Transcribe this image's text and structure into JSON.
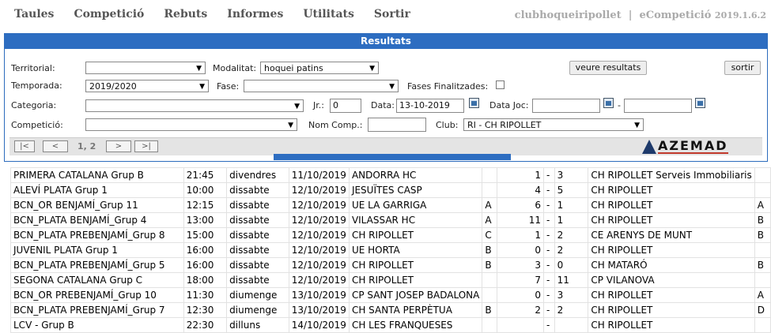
{
  "menu": [
    "Taules",
    "Competició",
    "Rebuts",
    "Informes",
    "Utilitats",
    "Sortir"
  ],
  "brand": {
    "club": "clubhoqueiripollet",
    "separator": "|",
    "app": "eCompetició",
    "version": "2019.1.6.2"
  },
  "panel_title": "Resultats",
  "filters": {
    "territorial_label": "Territorial:",
    "territorial_value": "",
    "modalitat_label": "Modalitat:",
    "modalitat_value": "hoquei patins",
    "veure_button": "veure resultats",
    "sortir_button": "sortir",
    "temporada_label": "Temporada:",
    "temporada_value": "2019/2020",
    "fase_label": "Fase:",
    "fase_value": "",
    "fases_finalitzades_label": "Fases Finalitzades:",
    "categoria_label": "Categoria:",
    "categoria_value": "",
    "jr_label": "Jr.:",
    "jr_value": "0",
    "data_label": "Data:",
    "data_value": "13-10-2019",
    "data_joc_label": "Data Joc:",
    "data_joc_from": "",
    "dash": "-",
    "data_joc_to": "",
    "competicio_label": "Competició:",
    "competicio_value": "",
    "nom_comp_label": "Nom Comp.:",
    "nom_comp_value": "",
    "club_label": "Club:",
    "club_value": "RI - CH RIPOLLET"
  },
  "pager": {
    "first": "|<",
    "prev": "<",
    "info": "1, 2",
    "next": ">",
    "last": ">|"
  },
  "logo_text": "AZEMAD",
  "rows": [
    {
      "comp": "PRIMERA CATALANA Grup B",
      "time": "21:45",
      "day": "divendres",
      "date": "11/10/2019",
      "home": "ANDORRA HC",
      "hl": "",
      "hs": "1",
      "sep": "-",
      "as": "3",
      "away": "CH RIPOLLET Serveis Immobiliaris",
      "al": ""
    },
    {
      "comp": "ALEVÍ PLATA Grup 1",
      "time": "10:00",
      "day": "dissabte",
      "date": "12/10/2019",
      "home": "JESUÏTES CASP",
      "hl": "",
      "hs": "4",
      "sep": "-",
      "as": "5",
      "away": "CH RIPOLLET",
      "al": ""
    },
    {
      "comp": "BCN_OR BENJAMÍ_Grup 11",
      "time": "12:15",
      "day": "dissabte",
      "date": "12/10/2019",
      "home": "UE LA GARRIGA",
      "hl": "A",
      "hs": "6",
      "sep": "-",
      "as": "1",
      "away": "CH RIPOLLET",
      "al": "A"
    },
    {
      "comp": "BCN_PLATA BENJAMÍ_Grup 4",
      "time": "13:00",
      "day": "dissabte",
      "date": "12/10/2019",
      "home": "VILASSAR HC",
      "hl": "A",
      "hs": "11",
      "sep": "-",
      "as": "1",
      "away": "CH RIPOLLET",
      "al": "B"
    },
    {
      "comp": "BCN_PLATA PREBENJAMÍ_Grup 8",
      "time": "15:00",
      "day": "dissabte",
      "date": "12/10/2019",
      "home": "CH RIPOLLET",
      "hl": "C",
      "hs": "1",
      "sep": "-",
      "as": "2",
      "away": "CE ARENYS DE MUNT",
      "al": "B"
    },
    {
      "comp": "JUVENIL PLATA Grup 1",
      "time": "16:00",
      "day": "dissabte",
      "date": "12/10/2019",
      "home": "UE HORTA",
      "hl": "B",
      "hs": "0",
      "sep": "-",
      "as": "2",
      "away": "CH RIPOLLET",
      "al": ""
    },
    {
      "comp": "BCN_PLATA PREBENJAMÍ_Grup 5",
      "time": "16:00",
      "day": "dissabte",
      "date": "12/10/2019",
      "home": "CH RIPOLLET",
      "hl": "B",
      "hs": "3",
      "sep": "-",
      "as": "0",
      "away": "CH MATARÓ",
      "al": "B"
    },
    {
      "comp": "SEGONA CATALANA Grup C",
      "time": "18:00",
      "day": "dissabte",
      "date": "12/10/2019",
      "home": "CH RIPOLLET",
      "hl": "",
      "hs": "7",
      "sep": "-",
      "as": "11",
      "away": "CP VILANOVA",
      "al": ""
    },
    {
      "comp": "BCN_OR PREBENJAMÍ_Grup 10",
      "time": "11:30",
      "day": "diumenge",
      "date": "13/10/2019",
      "home": "CP SANT JOSEP BADALONA",
      "hl": "",
      "hs": "0",
      "sep": "-",
      "as": "3",
      "away": "CH RIPOLLET",
      "al": "A"
    },
    {
      "comp": "BCN_PLATA PREBENJAMÍ_Grup 7",
      "time": "12:30",
      "day": "diumenge",
      "date": "13/10/2019",
      "home": "CH SANTA PERPÈTUA",
      "hl": "B",
      "hs": "2",
      "sep": "-",
      "as": "2",
      "away": "CH RIPOLLET",
      "al": "D"
    },
    {
      "comp": "LCV - Grup B",
      "time": "22:30",
      "day": "dilluns",
      "date": "14/10/2019",
      "home": "CH LES FRANQUESES",
      "hl": "",
      "hs": "",
      "sep": "-",
      "as": "",
      "away": "CH RIPOLLET",
      "al": ""
    }
  ]
}
